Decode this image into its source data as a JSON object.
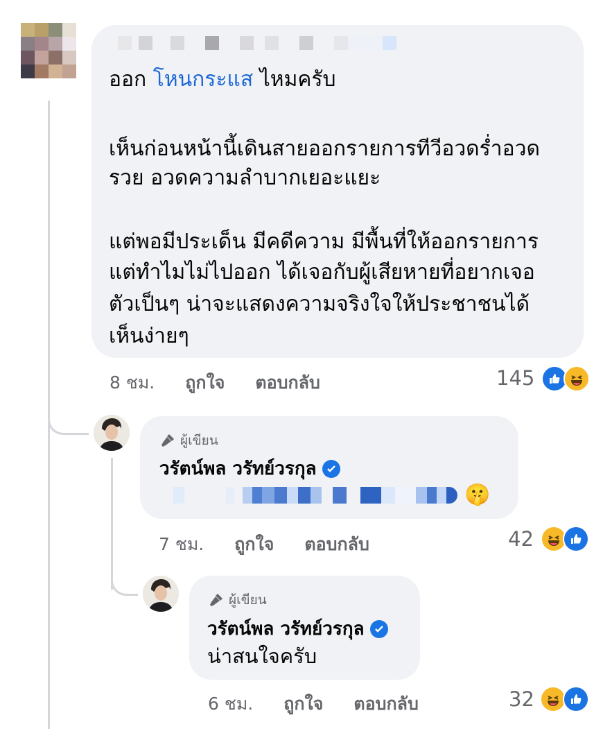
{
  "comment_main": {
    "line_1_prefix": "ออก ",
    "line_1_link": "โหนกระแส",
    "line_1_suffix": " ไหมครับ",
    "paragraph_2": [
      "เห็นก่อนหน้านี้เดินสายออกรายการทีวีอวดร่ำอวด",
      "รวย อวดความลำบากเยอะแยะ"
    ],
    "paragraph_3": [
      "แต่พอมีประเด็น มีคดีความ มีพื้นที่ให้ออกรายการ",
      "แต่ทำไมไม่ไปออก ได้เจอกับผู้เสียหายที่อยากเจอ",
      "ตัวเป็นๆ น่าจะแสดงความจริงใจให้ประชาชนได้",
      "เห็นง่ายๆ"
    ],
    "time": "8 ชม.",
    "like_label": "ถูกใจ",
    "reply_label": "ตอบกลับ",
    "reaction_count": "145",
    "reactions": [
      "like-icon",
      "haha-icon"
    ]
  },
  "reply_1": {
    "badge": "ผู้เขียน",
    "author": "วรัตน์พล วรัทย์วรกุล",
    "verified": true,
    "emoji": "🤫",
    "time": "7 ชม.",
    "like_label": "ถูกใจ",
    "reply_label": "ตอบกลับ",
    "reaction_count": "42",
    "reactions": [
      "haha-icon",
      "like-icon"
    ]
  },
  "reply_2": {
    "badge": "ผู้เขียน",
    "author": "วรัตน์พล วรัทย์วรกุล",
    "verified": true,
    "text": "น่าสนใจครับ",
    "time": "6 ชม.",
    "like_label": "ถูกใจ",
    "reply_label": "ตอบกลับ",
    "reaction_count": "32",
    "reactions": [
      "haha-icon",
      "like-icon"
    ]
  },
  "colors": {
    "bubble": "#f0f2f5",
    "link": "#1b67d6",
    "meta_text": "#65676b",
    "verified": "#1b74e4",
    "like_blue": "#1b74e4",
    "haha_yellow": "#f7b928"
  }
}
